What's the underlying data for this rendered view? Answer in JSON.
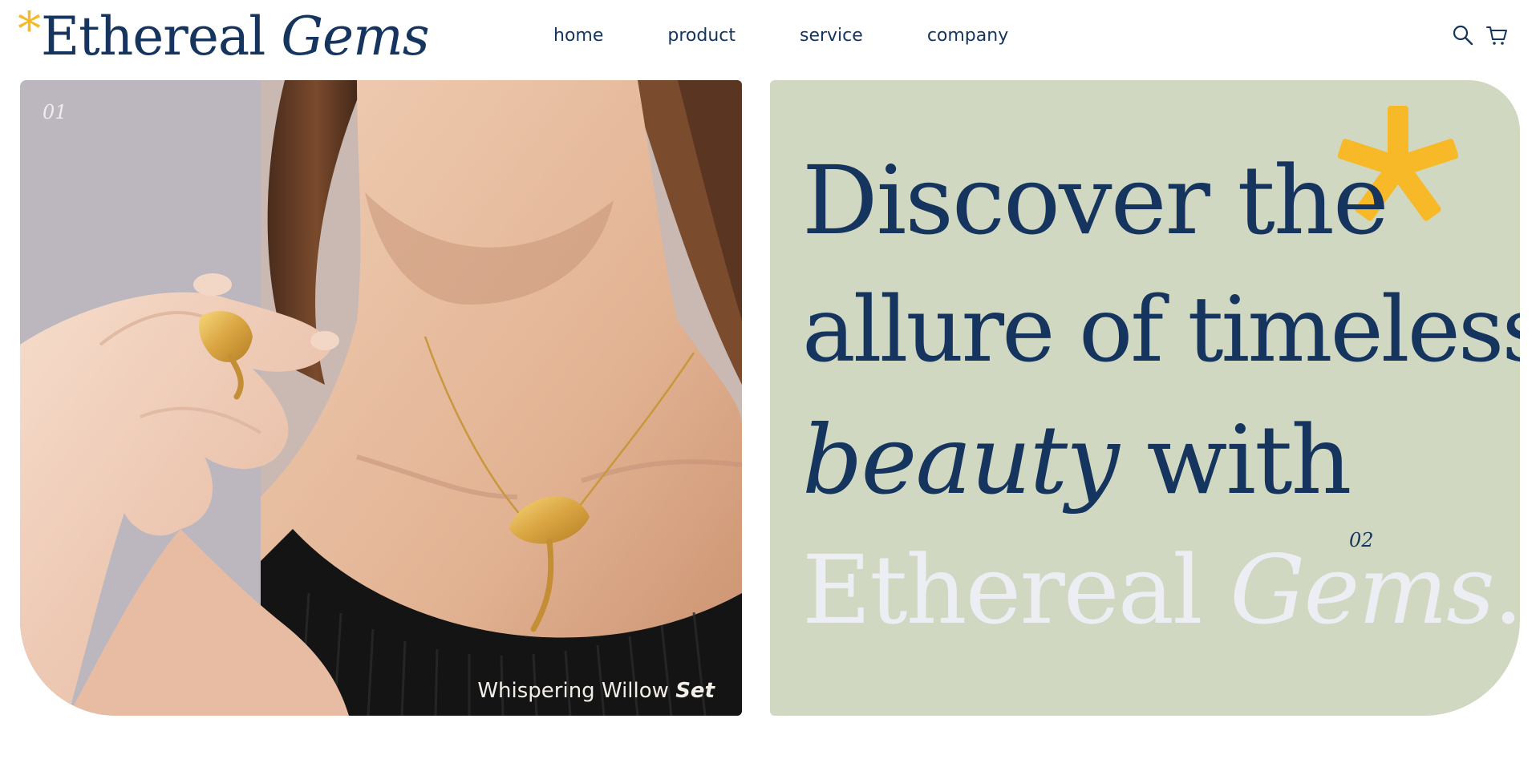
{
  "brand": {
    "star": "*",
    "name_regular": "Ethereal",
    "name_italic": "Gems"
  },
  "nav": {
    "items": [
      {
        "label": "home"
      },
      {
        "label": "product"
      },
      {
        "label": "service"
      },
      {
        "label": "company"
      }
    ]
  },
  "header_icons": [
    "search-icon",
    "cart-icon"
  ],
  "feature": {
    "index": "01",
    "caption_regular": "Whispering Willow",
    "caption_italic": "Set",
    "image_desc_icon": "necklace-photo"
  },
  "hero": {
    "line1": "Discover the",
    "line2": "allure of timeless",
    "line3_italic": "beauty",
    "line3_regular": " with",
    "line4_regular": "Ethereal ",
    "line4_italic": "Gems",
    "line4_end": ".",
    "index": "02"
  },
  "colors": {
    "brand_navy": "#15345e",
    "accent_yellow": "#f7b928",
    "hero_bg": "#d0d8c1",
    "highlight_white": "#eceef3"
  }
}
